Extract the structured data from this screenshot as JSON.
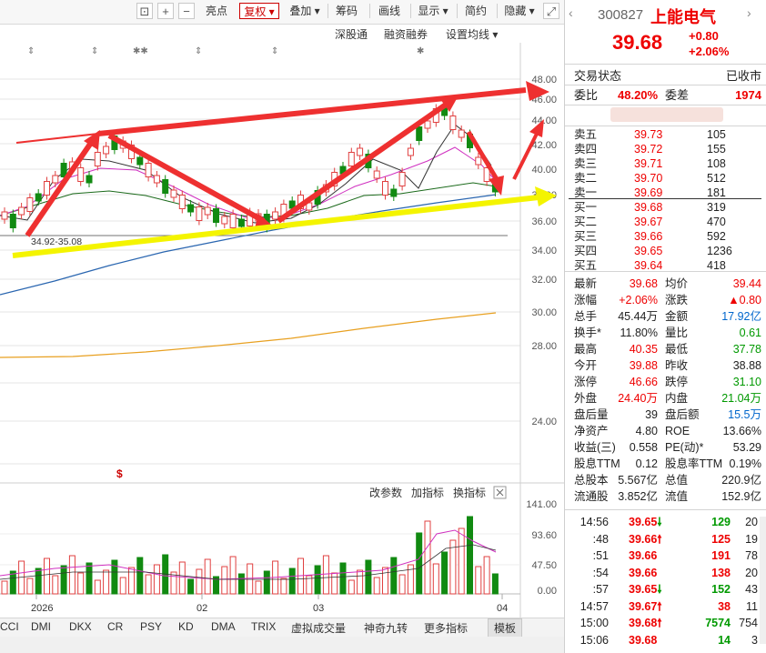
{
  "toolbar": {
    "items": [
      "亮点",
      "复权",
      "叠加",
      "筹码",
      "画线",
      "显示",
      "简约",
      "隐藏"
    ],
    "active": "复权"
  },
  "subbar": {
    "items": [
      "深股通",
      "融资融券",
      "设置均线"
    ]
  },
  "chart": {
    "price_axis": [
      "48.00",
      "46.00",
      "44.00",
      "42.00",
      "40.00",
      "38.00",
      "36.00",
      "34.00",
      "32.00",
      "30.00",
      "28.00",
      "24.00"
    ],
    "range_label": "34.92-35.08",
    "marker": "$",
    "indicator_header": [
      "改参数",
      "加指标",
      "换指标"
    ],
    "volume_axis": [
      "141.00",
      "93.60",
      "47.50",
      "0.00"
    ],
    "x_labels": [
      "2026",
      "02",
      "03",
      "04"
    ]
  },
  "bottom_tabs": [
    "CCI",
    "DMI",
    "DKX",
    "CR",
    "PSY",
    "KD",
    "DMA",
    "TRIX",
    "虚拟成交量",
    "神奇九转",
    "更多指标",
    "模板"
  ],
  "quote": {
    "code": "300827",
    "name": "上能电气",
    "price": "39.68",
    "change": "+0.80",
    "change_pct": "+2.06%",
    "status_label": "交易状态",
    "status_value": "已收市",
    "ratio_label": "委比",
    "ratio_value": "48.20%",
    "diff_label": "委差",
    "diff_value": "1974"
  },
  "asks": [
    {
      "label": "卖五",
      "price": "39.73",
      "vol": "105"
    },
    {
      "label": "卖四",
      "price": "39.72",
      "vol": "155"
    },
    {
      "label": "卖三",
      "price": "39.71",
      "vol": "108"
    },
    {
      "label": "卖二",
      "price": "39.70",
      "vol": "512"
    },
    {
      "label": "卖一",
      "price": "39.69",
      "vol": "181"
    }
  ],
  "bids": [
    {
      "label": "买一",
      "price": "39.68",
      "vol": "319"
    },
    {
      "label": "买二",
      "price": "39.67",
      "vol": "470"
    },
    {
      "label": "买三",
      "price": "39.66",
      "vol": "592"
    },
    {
      "label": "买四",
      "price": "39.65",
      "vol": "1236"
    },
    {
      "label": "买五",
      "price": "39.64",
      "vol": "418"
    }
  ],
  "stats": [
    {
      "l1": "最新",
      "v1": "39.68",
      "c1": "red",
      "l2": "均价",
      "v2": "39.44",
      "c2": "red"
    },
    {
      "l1": "涨幅",
      "v1": "+2.06%",
      "c1": "red",
      "l2": "涨跌",
      "v2": "▲0.80",
      "c2": "red"
    },
    {
      "l1": "总手",
      "v1": "45.44万",
      "c1": "dark",
      "l2": "金额",
      "v2": "17.92亿",
      "c2": "blue"
    },
    {
      "l1": "换手*",
      "v1": "11.80%",
      "c1": "dark",
      "l2": "量比",
      "v2": "0.61",
      "c2": "green"
    },
    {
      "l1": "最高",
      "v1": "40.35",
      "c1": "red",
      "l2": "最低",
      "v2": "37.78",
      "c2": "green"
    },
    {
      "l1": "今开",
      "v1": "39.88",
      "c1": "red",
      "l2": "昨收",
      "v2": "38.88",
      "c2": "dark"
    },
    {
      "l1": "涨停",
      "v1": "46.66",
      "c1": "red",
      "l2": "跌停",
      "v2": "31.10",
      "c2": "green"
    },
    {
      "l1": "外盘",
      "v1": "24.40万",
      "c1": "red",
      "l2": "内盘",
      "v2": "21.04万",
      "c2": "green"
    },
    {
      "l1": "盘后量",
      "v1": "39",
      "c1": "dark",
      "l2": "盘后额",
      "v2": "15.5万",
      "c2": "blue"
    },
    {
      "l1": "净资产",
      "v1": "4.80",
      "c1": "dark",
      "l2": "ROE",
      "v2": "13.66%",
      "c2": "dark"
    },
    {
      "l1": "收益(三)",
      "v1": "0.558",
      "c1": "dark",
      "l2": "PE(动)*",
      "v2": "53.29",
      "c2": "dark"
    },
    {
      "l1": "股息TTM",
      "v1": "0.12",
      "c1": "dark",
      "l2": "股息率TTM",
      "v2": "0.19%",
      "c2": "dark"
    },
    {
      "l1": "总股本",
      "v1": "5.567亿",
      "c1": "dark",
      "l2": "总值",
      "v2": "220.9亿",
      "c2": "dark"
    },
    {
      "l1": "流通股",
      "v1": "3.852亿",
      "c1": "dark",
      "l2": "流值",
      "v2": "152.9亿",
      "c2": "dark"
    }
  ],
  "ticks": [
    {
      "time": "14:56",
      "price": "39.65",
      "dir": "down",
      "vol": "129",
      "vc": "green",
      "n": "20"
    },
    {
      "time": ":48",
      "price": "39.66",
      "dir": "up",
      "vol": "125",
      "vc": "red",
      "n": "19"
    },
    {
      "time": ":51",
      "price": "39.66",
      "dir": "",
      "vol": "191",
      "vc": "red",
      "n": "78"
    },
    {
      "time": ":54",
      "price": "39.66",
      "dir": "",
      "vol": "138",
      "vc": "red",
      "n": "20"
    },
    {
      "time": ":57",
      "price": "39.65",
      "dir": "down",
      "vol": "152",
      "vc": "green",
      "n": "43"
    },
    {
      "time": "14:57",
      "price": "39.67",
      "dir": "up",
      "vol": "38",
      "vc": "red",
      "n": "11"
    },
    {
      "time": "15:00",
      "price": "39.68",
      "dir": "up",
      "vol": "7574",
      "vc": "green",
      "n": "754"
    },
    {
      "time": "15:06",
      "price": "39.68",
      "dir": "",
      "vol": "14",
      "vc": "green",
      "n": "3"
    }
  ]
}
